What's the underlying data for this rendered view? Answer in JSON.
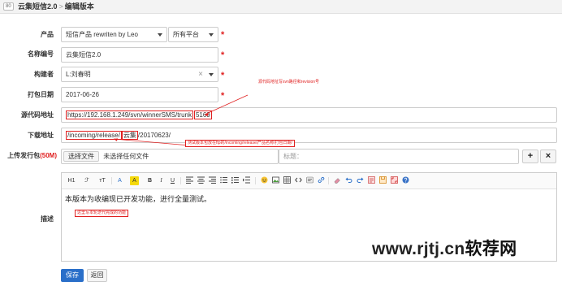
{
  "header": {
    "id_badge": "80",
    "breadcrumb_parent": "云集短信2.0",
    "breadcrumb_separator": ">",
    "breadcrumb_current": "编辑版本"
  },
  "form": {
    "product": {
      "label": "产品",
      "value": "短信产品 rewriten by Leo",
      "platform_value": "所有平台",
      "required_mark": "*"
    },
    "name": {
      "label": "名称编号",
      "value": "云集短信2.0",
      "required_mark": "*"
    },
    "builder": {
      "label": "构建者",
      "value": "L:刘春明",
      "clear_glyph": "×",
      "required_mark": "*"
    },
    "build_date": {
      "label": "打包日期",
      "value": "2017-06-26",
      "required_mark": "*"
    },
    "source_url": {
      "label": "源代码地址",
      "value": "https://192.168.1.249/svn/winnerSMS/trunk",
      "revision": "5169"
    },
    "download_url": {
      "label": "下载地址",
      "prefix": "/incoming/release/",
      "middle": "云集",
      "suffix": "/20170623/"
    },
    "upload": {
      "label": "上传发行包",
      "limit": "(50M)",
      "choose_button": "选择文件",
      "no_file_text": "未选择任何文件",
      "title_label": "标题：",
      "add_glyph": "+",
      "remove_glyph": "×"
    },
    "description": {
      "label": "描述",
      "content": "本版本为收编现已开发功能，进行全量测试。"
    }
  },
  "toolbar": {
    "heading": "H1",
    "font_family": "ℱ",
    "font_size": "тT",
    "font_color": "A",
    "highlight": "A",
    "bold": "B",
    "italic": "I",
    "underline": "U"
  },
  "annotations": {
    "source_note": "源代码地址写svn路径和revision号",
    "download_note": "测试版本包放在ftp的/incoming/release/产品名称/打包日期/",
    "desc_note": "这里写本轮迭代完成的功能"
  },
  "footer": {
    "save_label": "保存",
    "back_label": "返回"
  },
  "watermark": {
    "latin": "www.rjtj.cn",
    "cn": "软荐网"
  },
  "colors": {
    "accent": "#2a6fc9",
    "required": "#e02020",
    "annotation": "#e02020"
  }
}
